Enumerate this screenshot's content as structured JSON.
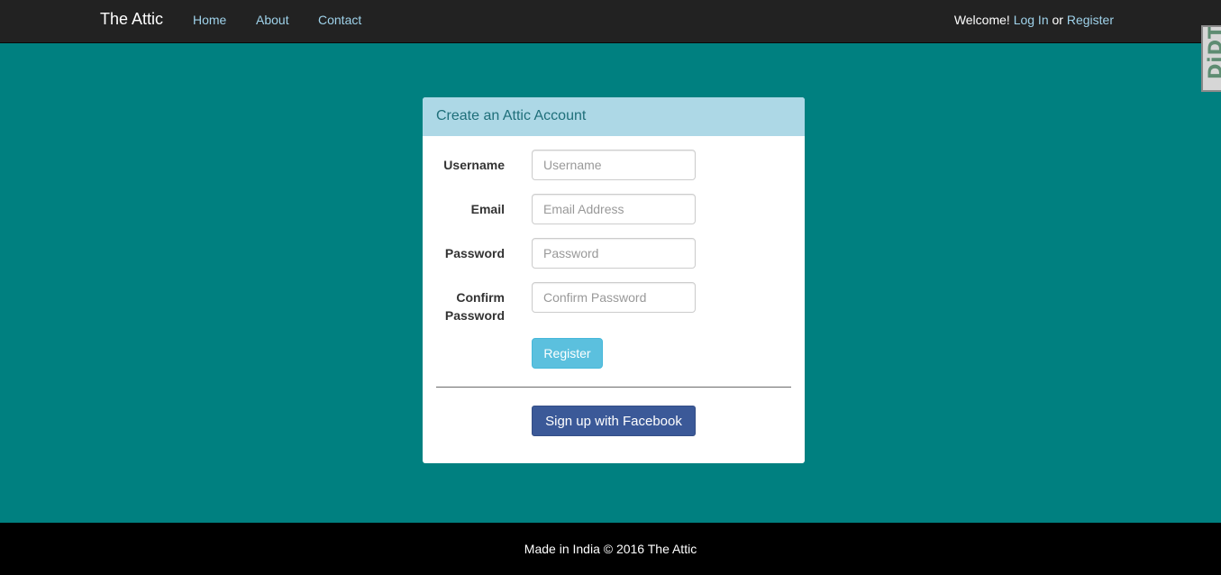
{
  "navbar": {
    "brand": "The Attic",
    "links": [
      {
        "label": "Home"
      },
      {
        "label": "About"
      },
      {
        "label": "Contact"
      }
    ],
    "welcome_text": "Welcome!",
    "login_label": "Log In",
    "or_text": "or",
    "register_label": "Register"
  },
  "side_widget": {
    "text": "DiDT"
  },
  "panel": {
    "heading": "Create an Attic Account",
    "fields": [
      {
        "label": "Username",
        "placeholder": "Username",
        "value": ""
      },
      {
        "label": "Email",
        "placeholder": "Email Address",
        "value": ""
      },
      {
        "label": "Password",
        "placeholder": "Password",
        "value": ""
      },
      {
        "label": "Confirm Password",
        "placeholder": "Confirm Password",
        "value": ""
      }
    ],
    "register_button": "Register",
    "facebook_button": "Sign up with Facebook"
  },
  "footer": {
    "text": "Made in India © 2016 The Attic"
  },
  "colors": {
    "background": "#008080",
    "navbar": "#222222",
    "panel_heading": "#add8e6",
    "register_button": "#5bc0de",
    "facebook_button": "#3b5998",
    "footer": "#000000"
  }
}
